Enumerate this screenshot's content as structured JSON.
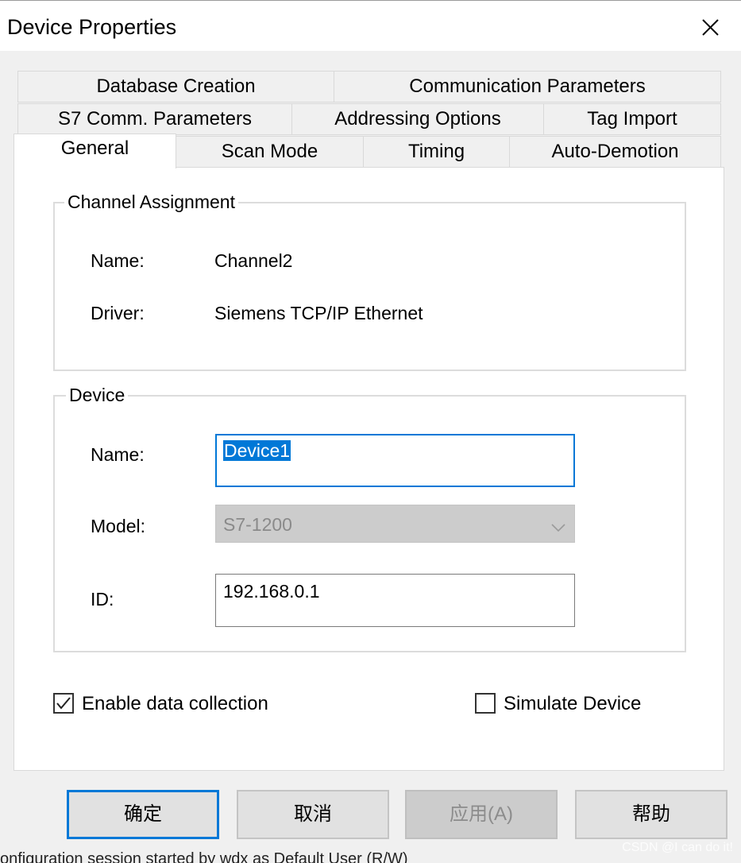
{
  "window": {
    "title": "Device Properties"
  },
  "tabs": {
    "row1": [
      "Database Creation",
      "Communication Parameters"
    ],
    "row2": [
      "S7 Comm. Parameters",
      "Addressing Options",
      "Tag Import"
    ],
    "row3": [
      "General",
      "Scan Mode",
      "Timing",
      "Auto-Demotion"
    ],
    "active": "General"
  },
  "channel_assignment": {
    "legend": "Channel Assignment",
    "name_label": "Name:",
    "name_value": "Channel2",
    "driver_label": "Driver:",
    "driver_value": "Siemens TCP/IP Ethernet"
  },
  "device": {
    "legend": "Device",
    "name_label": "Name:",
    "name_value": "Device1",
    "model_label": "Model:",
    "model_value": "S7-1200",
    "id_label": "ID:",
    "id_value": "192.168.0.1"
  },
  "options": {
    "enable_label": "Enable data collection",
    "enable_checked": true,
    "simulate_label": "Simulate Device",
    "simulate_checked": false
  },
  "buttons": {
    "ok": "确定",
    "cancel": "取消",
    "apply": "应用(A)",
    "help": "帮助"
  },
  "background_text": "onfiguration session started by wdx as Default User (R/W)",
  "watermark": "CSDN @I can do it!",
  "colors": {
    "accent": "#0078d7",
    "disabled": "#cccccc"
  }
}
